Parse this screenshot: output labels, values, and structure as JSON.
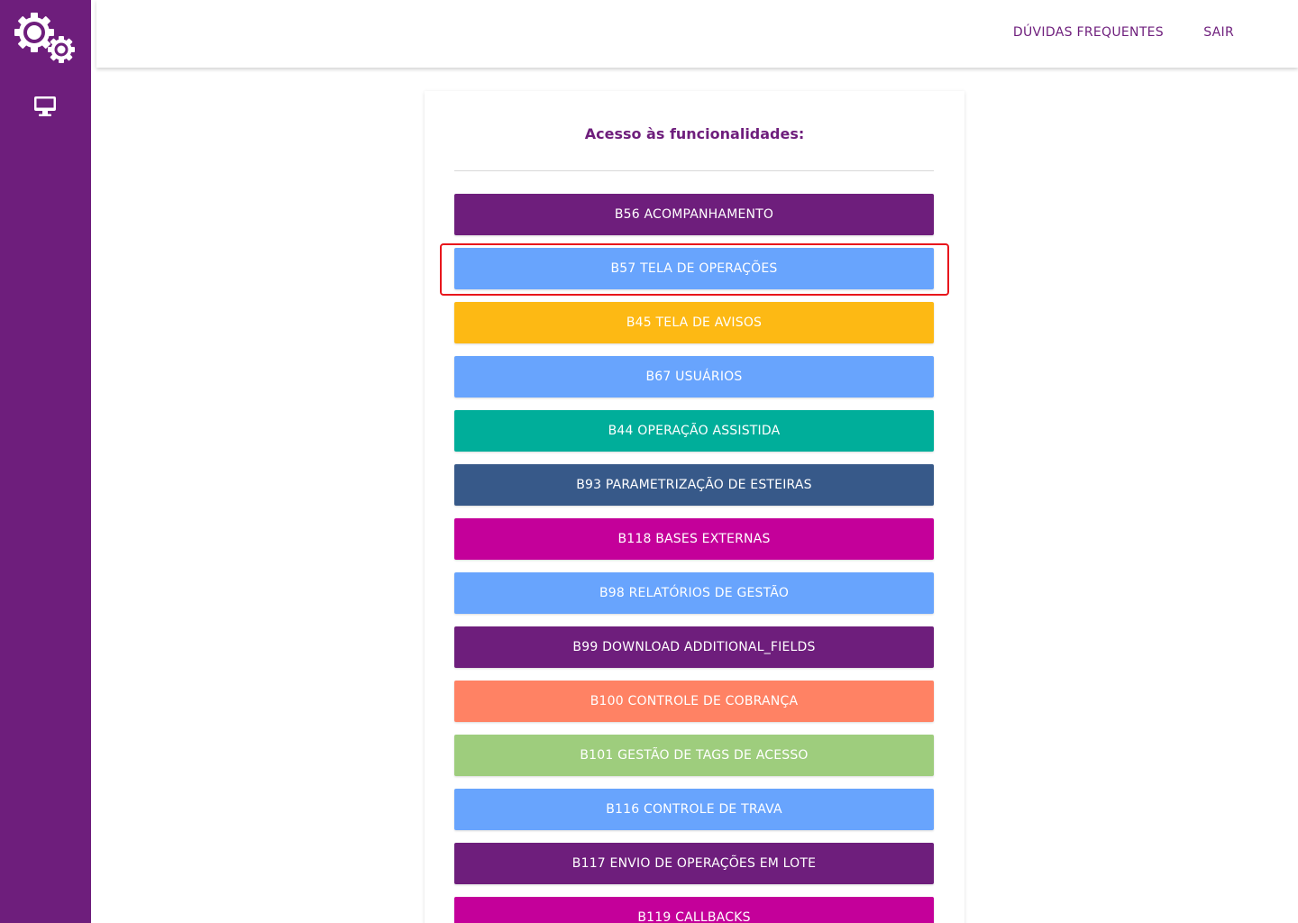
{
  "header": {
    "faq_label": "DÚVIDAS FREQUENTES",
    "logout_label": "SAIR"
  },
  "sidebar": {
    "logo_icon": "gears-icon",
    "items": [
      {
        "icon": "desktop-icon"
      }
    ]
  },
  "main": {
    "title": "Acesso às funcionalidades:",
    "buttons": [
      {
        "label": "B56 ACOMPANHAMENTO",
        "color": "#6e1e7c"
      },
      {
        "label": "B57 TELA DE OPERAÇÕES",
        "color": "#68a4fd"
      },
      {
        "label": "B45 TELA DE AVISOS",
        "color": "#fdb914"
      },
      {
        "label": "B67 USUÁRIOS",
        "color": "#68a4fd"
      },
      {
        "label": "B44 OPERAÇÃO ASSISTIDA",
        "color": "#00ae9a"
      },
      {
        "label": "B93 PARAMETRIZAÇÃO DE ESTEIRAS",
        "color": "#375989"
      },
      {
        "label": "B118 BASES EXTERNAS",
        "color": "#c4009a"
      },
      {
        "label": "B98 RELATÓRIOS DE GESTÃO",
        "color": "#68a4fd"
      },
      {
        "label": "B99 DOWNLOAD ADDITIONAL_FIELDS",
        "color": "#6e1e7c"
      },
      {
        "label": "B100 CONTROLE DE COBRANÇA",
        "color": "#ff8264"
      },
      {
        "label": "B101 GESTÃO DE TAGS DE ACESSO",
        "color": "#9ecd7d"
      },
      {
        "label": "B116 CONTROLE DE TRAVA",
        "color": "#68a4fd"
      },
      {
        "label": "B117 ENVIO DE OPERAÇÕES EM LOTE",
        "color": "#6e1e7c"
      },
      {
        "label": "B119 CALLBACKS",
        "color": "#c4009a"
      }
    ]
  },
  "colors": {
    "sidebar": "#6e1e7c",
    "accent_text": "#6e1e7c",
    "highlight_outline": "#e8161c"
  }
}
